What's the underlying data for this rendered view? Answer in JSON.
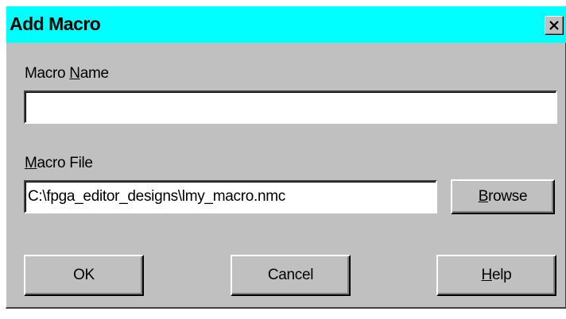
{
  "window": {
    "title": "Add Macro",
    "close_icon": "close-x-icon"
  },
  "macro_name": {
    "label_pre": "Macro ",
    "label_mnemonic": "N",
    "label_post": "ame",
    "value": ""
  },
  "macro_file": {
    "label_pre": "",
    "label_mnemonic": "M",
    "label_post": "acro File",
    "value": "C:\\fpga_editor_designs\\lmy_macro.nmc"
  },
  "buttons": {
    "browse": {
      "pre": "",
      "mnemonic": "B",
      "post": "rowse"
    },
    "ok": {
      "label": "OK"
    },
    "cancel": {
      "label": "Cancel"
    },
    "help": {
      "pre": "",
      "mnemonic": "H",
      "post": "elp"
    }
  },
  "colors": {
    "title_bar": "#00ffff",
    "dialog_face": "#c0c0c0"
  }
}
